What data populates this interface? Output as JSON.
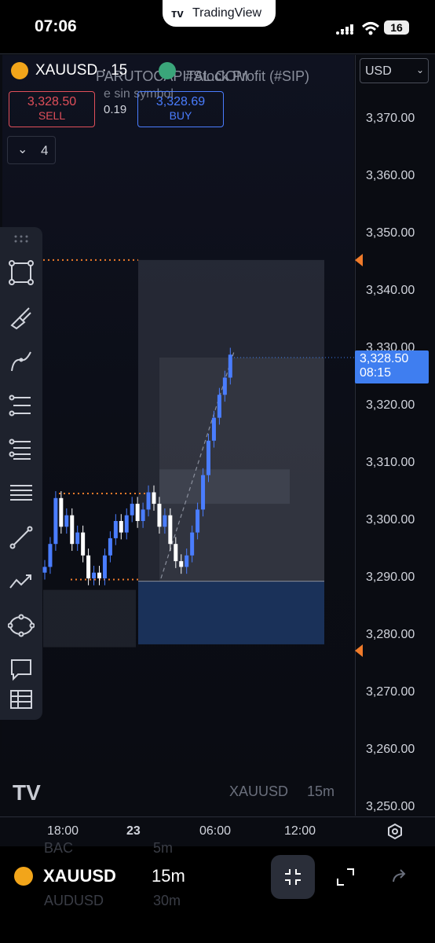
{
  "status_bar": {
    "time": "07:06",
    "app_pill": "TradingView",
    "battery": "16"
  },
  "header": {
    "symbol": "XAUUSD · 15",
    "watermark": "PARUTOCAPITAL.COM",
    "indicator": "#Stock Profit (#SIP)",
    "indicator_sub": "e sin  symbol",
    "sell_price": "3,328.50",
    "sell_label": "SELL",
    "spread": "0.19",
    "buy_price": "3,328.69",
    "buy_label": "BUY",
    "indicators_count": "4"
  },
  "price_axis": {
    "currency": "USD",
    "labels": [
      "3,370.00",
      "3,360.00",
      "3,350.00",
      "3,340.00",
      "3,330.00",
      "3,320.00",
      "3,310.00",
      "3,300.00",
      "3,290.00",
      "3,280.00",
      "3,270.00",
      "3,260.00",
      "3,250.00"
    ],
    "last_price": "3,328.50",
    "countdown": "08:15"
  },
  "time_axis": {
    "labels": [
      "18:00",
      "23",
      "06:00",
      "12:00"
    ]
  },
  "chart_watermark": {
    "symbol": "XAUUSD",
    "interval": "15m"
  },
  "toolbar": {
    "items": [
      "drag-handle",
      "rectangle",
      "brush",
      "path",
      "fib-retracement",
      "fib-extension",
      "horizontal-lines",
      "trend-line",
      "pattern",
      "ellipse",
      "callout",
      "table"
    ]
  },
  "bottom_bar": {
    "symbol": "XAUUSD",
    "interval": "15m",
    "ghost": [
      "BAC",
      "5m",
      "AUDUSD",
      "30m"
    ]
  },
  "colors": {
    "buy": "#4a7dff",
    "sell": "#e04f5a",
    "last_price": "#3f7ef0",
    "marker": "#f07b2a"
  },
  "chart_data": {
    "type": "candlestick",
    "symbol": "XAUUSD",
    "interval": "15m",
    "ylim": [
      3250,
      3375
    ],
    "x_ticks": [
      "18:00",
      "23",
      "06:00",
      "12:00"
    ],
    "candles_close": [
      3292,
      3296,
      3304,
      3299,
      3301,
      3296,
      3298,
      3294,
      3290,
      3291,
      3290,
      3294,
      3297,
      3300,
      3298,
      3301,
      3303,
      3300,
      3302,
      3305,
      3303,
      3299,
      3301,
      3296,
      3293,
      3292,
      3294,
      3298,
      3302,
      3308,
      3314,
      3318,
      3322,
      3325,
      3329
    ],
    "last_price": 3328.5,
    "levels": [
      3345.5,
      3304.8,
      3289.8
    ],
    "zones": [
      {
        "from": 3289.5,
        "to": 3345.5,
        "shade": "light"
      },
      {
        "from": 3278.5,
        "to": 3289.5,
        "shade": "blue"
      },
      {
        "from": 3303,
        "to": 3309,
        "shade": "light"
      },
      {
        "from": 3278,
        "to": 3288,
        "shade": "gray"
      }
    ]
  }
}
